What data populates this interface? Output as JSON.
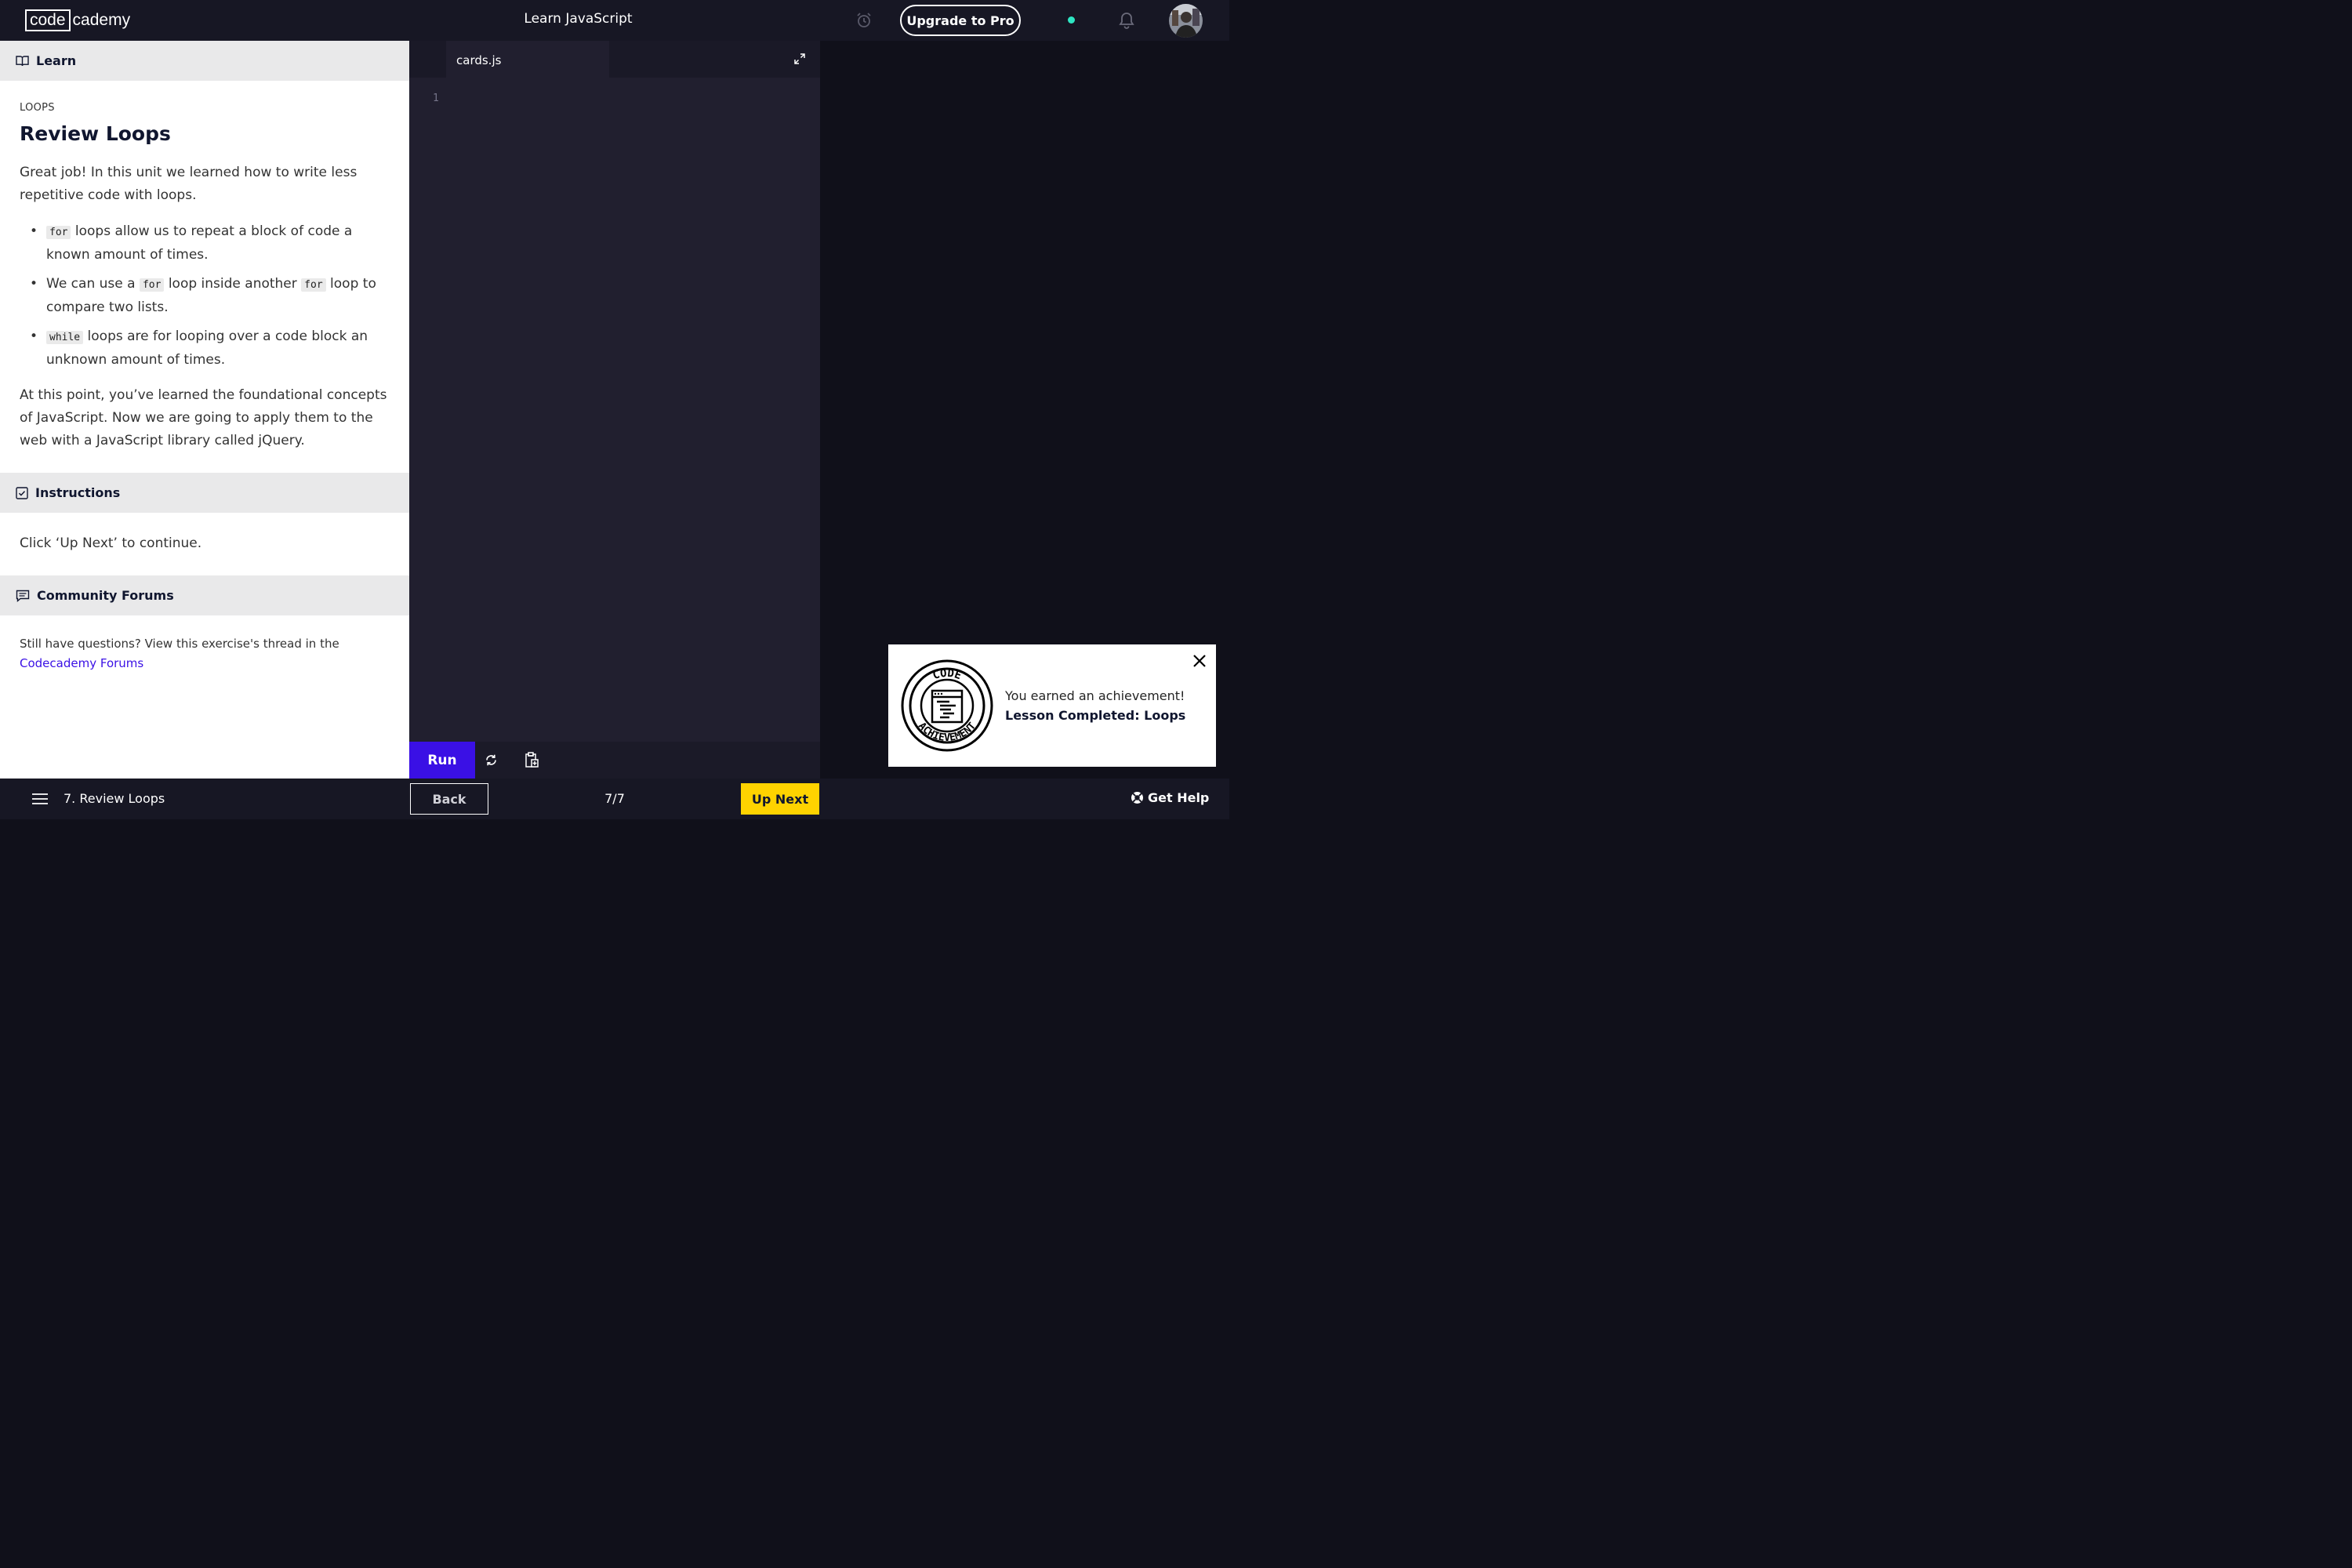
{
  "colors": {
    "accent": "#3a10e5",
    "next": "#ffd300",
    "status_dot": "#2ee6c3",
    "dark": "#10101a"
  },
  "header": {
    "logo_box": "code",
    "logo_rest": "cademy",
    "title": "Learn JavaScript",
    "upgrade_label": "Upgrade to Pro",
    "icons": [
      "alarm-clock-icon",
      "notification-bell-icon"
    ]
  },
  "learn": {
    "section_label": "Learn",
    "eyebrow": "LOOPS",
    "title": "Review Loops",
    "intro": "Great job! In this unit we learned how to write less repetitive code with loops.",
    "bullets": [
      {
        "code": "for",
        "text": " loops allow us to repeat a block of code a known amount of times."
      },
      {
        "pre": "We can use a ",
        "code": "for",
        "mid": " loop inside another ",
        "code2": "for",
        "text": " loop to compare two lists."
      },
      {
        "code": "while",
        "text": " loops are for looping over a code block an unknown amount of times."
      }
    ],
    "outro": "At this point, you’ve learned the foundational concepts of JavaScript. Now we are going to apply them to the web with a JavaScript library called jQuery."
  },
  "instructions": {
    "section_label": "Instructions",
    "text": "Click ‘Up Next’ to continue."
  },
  "forums": {
    "section_label": "Community Forums",
    "text": "Still have questions? View this exercise's thread in the",
    "link": "Codecademy Forums"
  },
  "editor": {
    "tab": "cards.js",
    "line_number": "1",
    "run_label": "Run"
  },
  "toast": {
    "line1": "You earned an achievement!",
    "line2": "Lesson Completed: Loops",
    "badge_top": "CODE",
    "badge_bottom": "ACHIEVEMENT"
  },
  "footer": {
    "lesson": "7. Review Loops",
    "back_label": "Back",
    "progress": "7/7",
    "next_label": "Up Next",
    "help_label": "Get Help"
  }
}
